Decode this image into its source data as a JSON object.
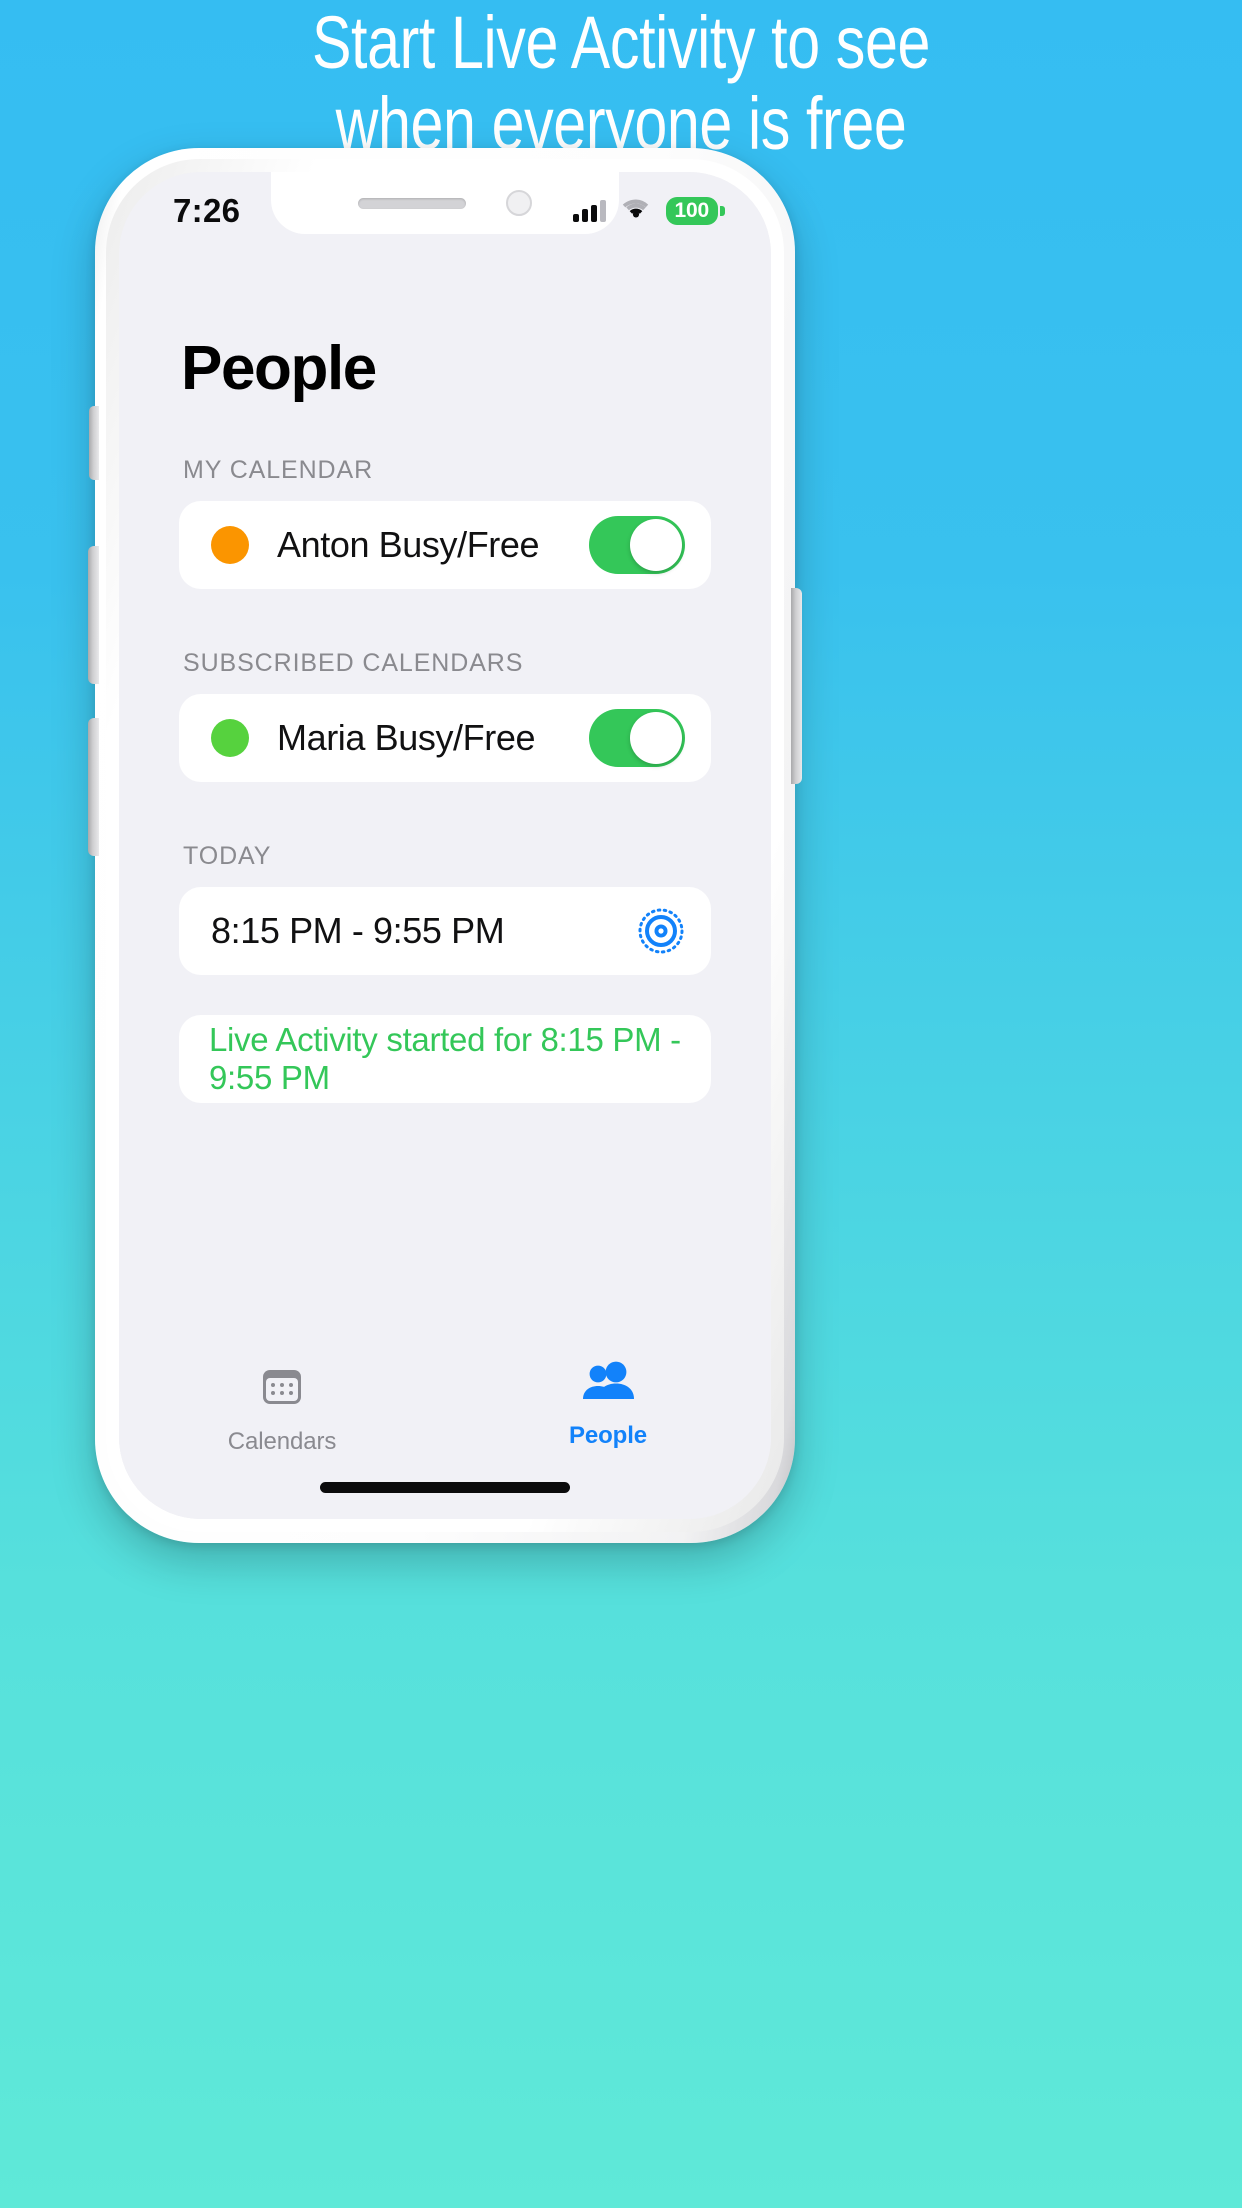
{
  "headline": "Start Live Activity to see\nwhen everyone is free",
  "colors": {
    "bg_top": "#35bdf2",
    "bg_bottom": "#5fe9d8",
    "accent_blue": "#1282fa",
    "toggle_green": "#34c759",
    "status_green": "#34c759",
    "anton_dot": "#fb9500",
    "maria_dot": "#56d23e",
    "screen_bg": "#f1f1f6"
  },
  "status_bar": {
    "time": "7:26",
    "signal_icon": "cellular-signal-icon",
    "wifi_icon": "wifi-icon",
    "battery_level": "100",
    "battery_icon": "battery-icon"
  },
  "page": {
    "title": "People"
  },
  "sections": [
    {
      "header": "MY CALENDAR",
      "rows": [
        {
          "dot_color": "#fb9500",
          "label": "Anton Busy/Free",
          "toggle_on": true
        }
      ]
    },
    {
      "header": "SUBSCRIBED CALENDARS",
      "rows": [
        {
          "dot_color": "#56d23e",
          "label": "Maria Busy/Free",
          "toggle_on": true
        }
      ]
    },
    {
      "header": "TODAY",
      "rows": [
        {
          "label": "8:15 PM - 9:55 PM",
          "trailing_icon": "live-activity-target-icon"
        }
      ]
    }
  ],
  "status_message": {
    "text": "Live Activity started for 8:15 PM - 9:55 PM"
  },
  "tab_bar": {
    "tabs": [
      {
        "icon": "calendar-icon",
        "label": "Calendars",
        "active": false
      },
      {
        "icon": "people-icon",
        "label": "People",
        "active": true
      }
    ]
  }
}
